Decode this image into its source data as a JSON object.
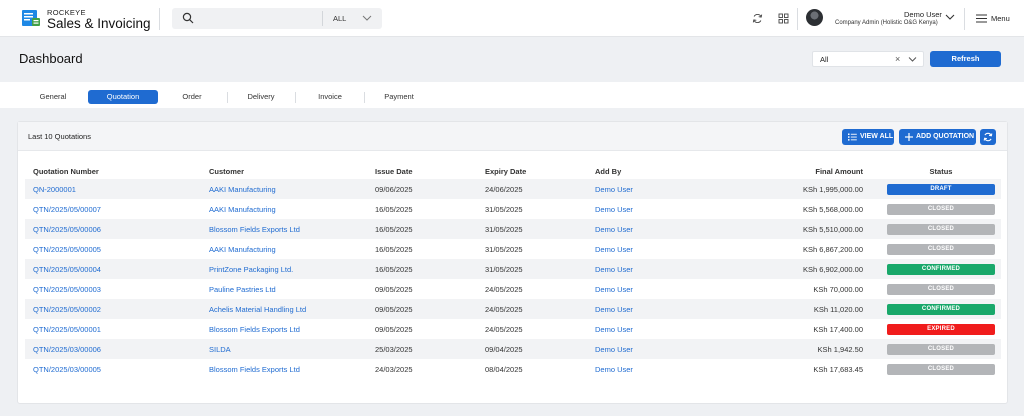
{
  "app": {
    "brand_top": "ROCKEYE",
    "brand_main": "Sales & Invoicing"
  },
  "search": {
    "placeholder": "",
    "scope": "ALL"
  },
  "user": {
    "name": "Demo User",
    "role": "Company Admin (Holistic O&G Kenya)"
  },
  "menu_label": "Menu",
  "dashboard": {
    "title": "Dashboard",
    "filter_value": "All",
    "refresh_label": "Refresh"
  },
  "tabs": [
    {
      "label": "General"
    },
    {
      "label": "Quotation",
      "active": true
    },
    {
      "label": "Order"
    },
    {
      "label": "Delivery"
    },
    {
      "label": "Invoice"
    },
    {
      "label": "Payment"
    }
  ],
  "card": {
    "title": "Last 10 Quotations",
    "view_all": "VIEW ALL",
    "add_quotation": "ADD QUOTATION"
  },
  "table": {
    "columns": [
      "Quotation Number",
      "Customer",
      "Issue Date",
      "Expiry Date",
      "Add By",
      "Final Amount",
      "Status"
    ],
    "rows": [
      {
        "number": "QN-2000001",
        "customer": "AAKI Manufacturing",
        "issue": "09/06/2025",
        "expiry": "24/06/2025",
        "by": "Demo User",
        "amount": "KSh 1,995,000.00",
        "status": "DRAFT"
      },
      {
        "number": "QTN/2025/05/00007",
        "customer": "AAKI Manufacturing",
        "issue": "16/05/2025",
        "expiry": "31/05/2025",
        "by": "Demo User",
        "amount": "KSh 5,568,000.00",
        "status": "CLOSED"
      },
      {
        "number": "QTN/2025/05/00006",
        "customer": "Blossom Fields Exports Ltd",
        "issue": "16/05/2025",
        "expiry": "31/05/2025",
        "by": "Demo User",
        "amount": "KSh 5,510,000.00",
        "status": "CLOSED"
      },
      {
        "number": "QTN/2025/05/00005",
        "customer": "AAKI Manufacturing",
        "issue": "16/05/2025",
        "expiry": "31/05/2025",
        "by": "Demo User",
        "amount": "KSh 6,867,200.00",
        "status": "CLOSED"
      },
      {
        "number": "QTN/2025/05/00004",
        "customer": "PrintZone Packaging Ltd.",
        "issue": "16/05/2025",
        "expiry": "31/05/2025",
        "by": "Demo User",
        "amount": "KSh 6,902,000.00",
        "status": "CONFIRMED"
      },
      {
        "number": "QTN/2025/05/00003",
        "customer": "Pauline Pastries Ltd",
        "issue": "09/05/2025",
        "expiry": "24/05/2025",
        "by": "Demo User",
        "amount": "KSh 70,000.00",
        "status": "CLOSED"
      },
      {
        "number": "QTN/2025/05/00002",
        "customer": "Achelis Material Handling Ltd",
        "issue": "09/05/2025",
        "expiry": "24/05/2025",
        "by": "Demo User",
        "amount": "KSh 11,020.00",
        "status": "CONFIRMED"
      },
      {
        "number": "QTN/2025/05/00001",
        "customer": "Blossom Fields Exports Ltd",
        "issue": "09/05/2025",
        "expiry": "24/05/2025",
        "by": "Demo User",
        "amount": "KSh 17,400.00",
        "status": "EXPIRED"
      },
      {
        "number": "QTN/2025/03/00006",
        "customer": "SILDA",
        "issue": "25/03/2025",
        "expiry": "09/04/2025",
        "by": "Demo User",
        "amount": "KSh 1,942.50",
        "status": "CLOSED"
      },
      {
        "number": "QTN/2025/03/00005",
        "customer": "Blossom Fields Exports Ltd",
        "issue": "24/03/2025",
        "expiry": "08/04/2025",
        "by": "Demo User",
        "amount": "KSh 17,683.45",
        "status": "CLOSED"
      }
    ]
  },
  "status_colors": {
    "DRAFT": "#1f6bd1",
    "CLOSED": "#b3b5b8",
    "CONFIRMED": "#19a86a",
    "EXPIRED": "#f01c1c"
  },
  "icons": {
    "search": "search-icon",
    "sync": "sync-icon",
    "apps": "apps-grid-icon",
    "menu": "hamburger-icon"
  }
}
